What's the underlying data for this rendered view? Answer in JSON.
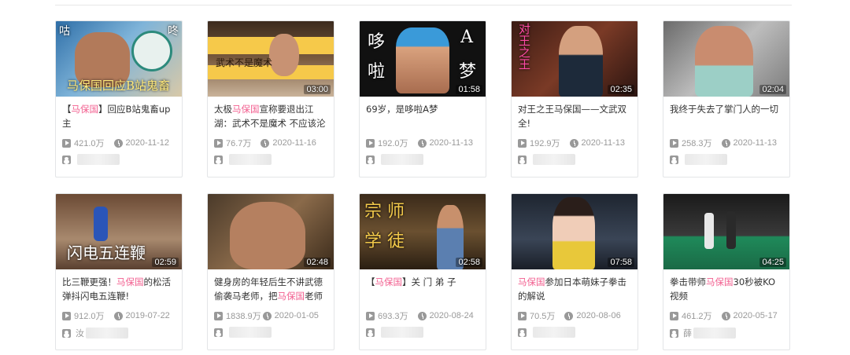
{
  "videos": [
    {
      "title_pre": "【",
      "title_hl": "马保国",
      "title_post": "】回应B站鬼畜up主",
      "duration": "",
      "views": "421.0万",
      "date": "2020-11-12",
      "uploader": "",
      "overlay": "马保国回应B站鬼畜",
      "corner_left": "咕",
      "corner_right": "咚"
    },
    {
      "title_pre": "太极",
      "title_hl": "马保国",
      "title_post": "宣称要退出江湖：武术不是魔术 不应该沦",
      "duration": "03:00",
      "views": "76.7万",
      "date": "2020-11-16",
      "uploader": "",
      "overlay": "武术不是魔术"
    },
    {
      "title_pre": "",
      "title_hl": "",
      "title_post": "69岁，是哆啦A梦",
      "duration": "01:58",
      "views": "192.0万",
      "date": "2020-11-13",
      "uploader": "",
      "overlay_l1": "哆",
      "overlay_l2": "啦",
      "overlay_r1": "A",
      "overlay_r2": "梦"
    },
    {
      "title_pre": "",
      "title_hl": "",
      "title_post": "对王之王马保国——文武双全!",
      "duration": "02:35",
      "views": "192.9万",
      "date": "2020-11-13",
      "uploader": "",
      "overlay": "对王之王"
    },
    {
      "title_pre": "",
      "title_hl": "",
      "title_post": "我终于失去了掌门人的一切",
      "duration": "02:04",
      "views": "258.3万",
      "date": "2020-11-13",
      "uploader": ""
    },
    {
      "title_pre": "比三鞭更强！",
      "title_hl": "马保国",
      "title_post": "的松活弹抖闪电五连鞭!",
      "duration": "02:59",
      "views": "912.0万",
      "date": "2019-07-22",
      "uploader": "汝",
      "overlay": "闪电五连鞭"
    },
    {
      "title_pre": "健身房的年轻后生不讲武德偷袭马老师，把",
      "title_hl": "马保国",
      "title_post": "老师",
      "duration": "02:48",
      "views": "1838.9万",
      "date": "2020-01-05",
      "uploader": ""
    },
    {
      "title_pre": "【",
      "title_hl": "马保国",
      "title_post": "】关 门 弟 子",
      "duration": "02:58",
      "views": "693.3万",
      "date": "2020-08-24",
      "uploader": "",
      "overlay_l1": "宗 师",
      "overlay_l2": "学 徒"
    },
    {
      "title_pre": "",
      "title_hl": "马保国",
      "title_post": "参加日本萌妹子拳击的解说",
      "duration": "07:58",
      "views": "70.5万",
      "date": "2020-08-06",
      "uploader": ""
    },
    {
      "title_pre": "拳击带师",
      "title_hl": "马保国",
      "title_post": "30秒被KO视频",
      "duration": "04:25",
      "views": "461.2万",
      "date": "2020-05-17",
      "uploader": "薛"
    }
  ]
}
